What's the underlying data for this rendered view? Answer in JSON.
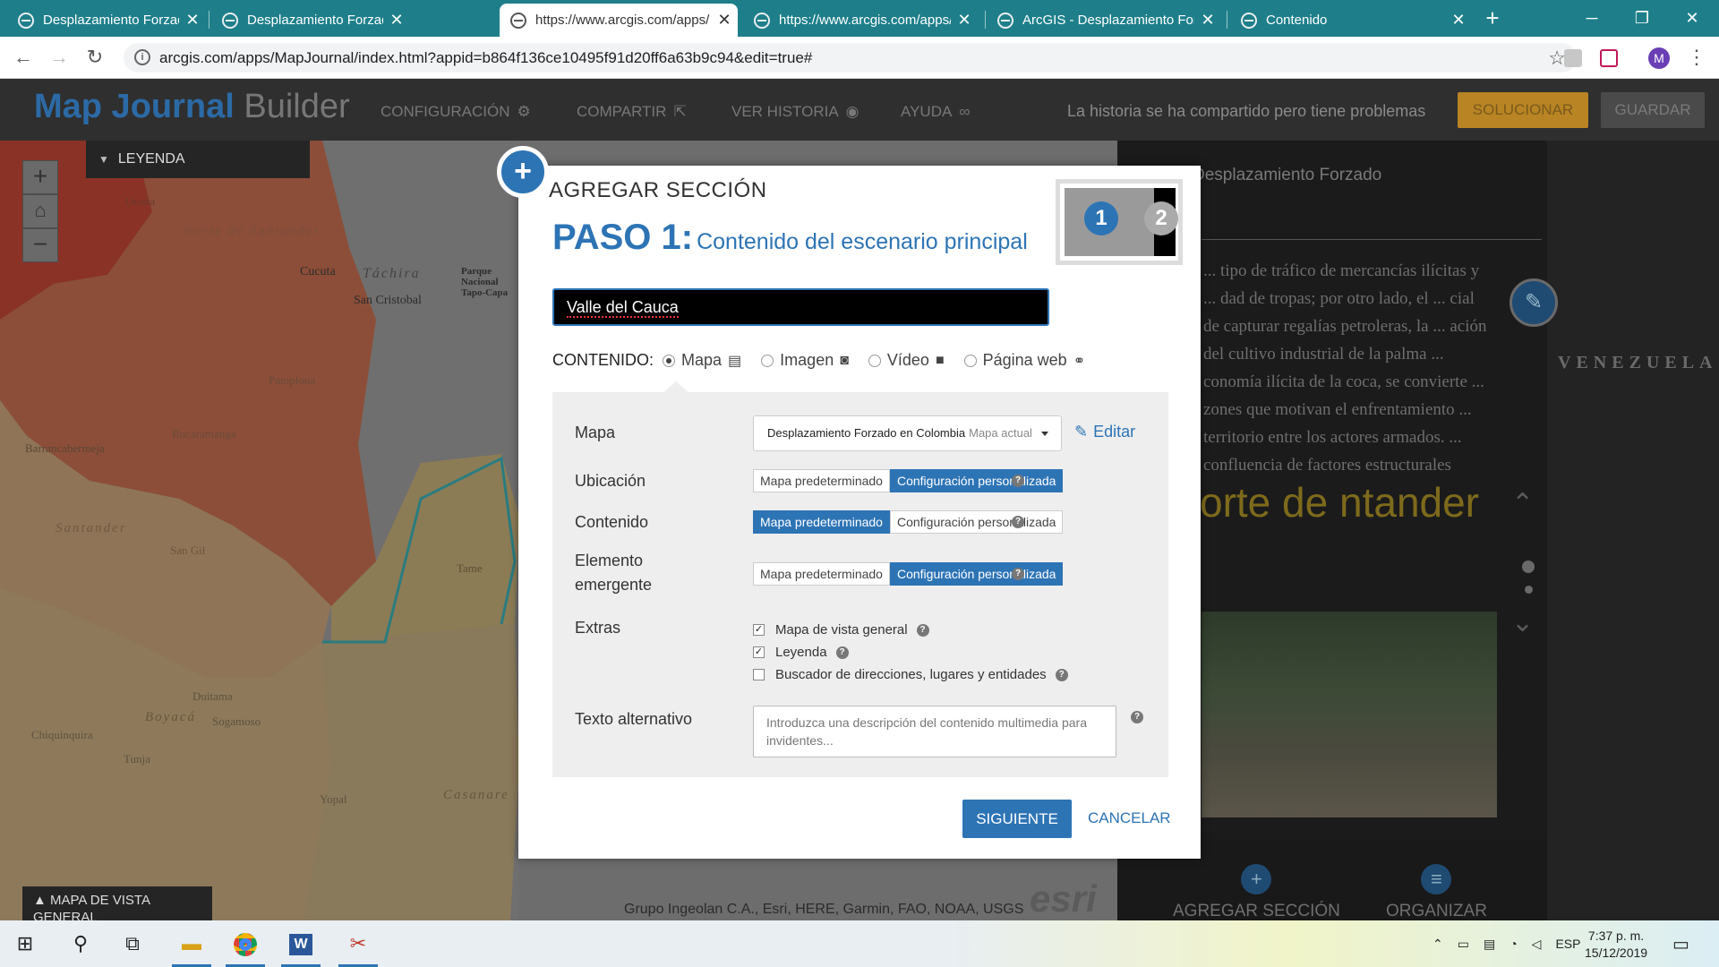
{
  "browser": {
    "tabs": [
      {
        "title": "Desplazamiento Forzado en C",
        "active": false
      },
      {
        "title": "Desplazamiento Forzado en C",
        "active": false
      },
      {
        "title": "https://www.arcgis.com/apps/",
        "active": true
      },
      {
        "title": "https://www.arcgis.com/apps/",
        "active": false
      },
      {
        "title": "ArcGIS - Desplazamiento For",
        "active": false
      },
      {
        "title": "Contenido",
        "active": false
      }
    ],
    "url": "arcgis.com/apps/MapJournal/index.html?appid=b864f136ce10495f91d20ff6a63b9c94&edit=true#",
    "profile_initial": "M"
  },
  "header": {
    "brand_bold": "Map Journal",
    "brand_light": " Builder",
    "nav": [
      {
        "label": "CONFIGURACIÓN",
        "icon": "gear-icon"
      },
      {
        "label": "COMPARTIR",
        "icon": "share-icon"
      },
      {
        "label": "VER HISTORIA",
        "icon": "eye-icon"
      },
      {
        "label": "AYUDA",
        "icon": "binoculars-icon"
      }
    ],
    "share_status": "La historia se ha compartido pero tiene problemas",
    "fix_label": "SOLUCIONAR",
    "save_label": "GUARDAR"
  },
  "map": {
    "legend_label": "LEYENDA",
    "overview_label": "MAPA DE VISTA GENERAL",
    "attribution": "Grupo Ingeolan C.A., Esri, HERE, Garmin, FAO, NOAA, USGS",
    "esri_logo": "esri",
    "places": [
      "Norte de Santander",
      "Cucuta",
      "San Cristobal",
      "Táchira",
      "Parque Nacional Tapo-Capa",
      "Ocaña",
      "Pamplona",
      "Bucaramanga",
      "Barrancabermeja",
      "Santander",
      "San Gil",
      "Tame",
      "Duitama",
      "Boyacá",
      "Sogamoso",
      "Chiquinquira",
      "Tunja",
      "Yopal",
      "Casanare"
    ]
  },
  "panel": {
    "map_title": "Desplazamiento Forzado",
    "body_text": "... tipo de tráfico de mercancías ilícitas y ... dad de tropas; por otro lado, el ... cial de capturar regalías petroleras, la ... ación del cultivo industrial de la palma ... conomía ilícita de la coca, se convierte ... zones que motivan el enfrentamiento ... territorio entre los actores armados. ... confluencia de factores estructurales",
    "heading": "orte de ntander",
    "venezuela": "VENEZUELA",
    "add_section": "AGREGAR SECCIÓN",
    "organize": "ORGANIZAR"
  },
  "dialog": {
    "title": "AGREGAR SECCIÓN",
    "step_label": "PASO 1:",
    "step_desc": "Contenido del escenario principal",
    "step_numbers": [
      "1",
      "2"
    ],
    "section_title_value": "Valle del Cauca",
    "content_label": "CONTENIDO:",
    "content_options": [
      {
        "label": "Mapa",
        "selected": true,
        "icon": "map-icon"
      },
      {
        "label": "Imagen",
        "selected": false,
        "icon": "camera-icon"
      },
      {
        "label": "Vídeo",
        "selected": false,
        "icon": "video-icon"
      },
      {
        "label": "Página web",
        "selected": false,
        "icon": "link-icon"
      }
    ],
    "map_label": "Mapa",
    "map_select_value": "Desplazamiento Forzado en Colombia",
    "map_select_suffix": "Mapa actual",
    "edit_label": "Editar",
    "rows": [
      {
        "label": "Ubicación",
        "options": [
          "Mapa predeterminado",
          "Configuración personalizada"
        ],
        "selected": 1
      },
      {
        "label": "Contenido",
        "options": [
          "Mapa predeterminado",
          "Configuración personalizada"
        ],
        "selected": 0
      },
      {
        "label": "Elemento emergente",
        "options": [
          "Mapa predeterminado",
          "Configuración personalizada"
        ],
        "selected": 1
      }
    ],
    "extras_label": "Extras",
    "extras": [
      {
        "label": "Mapa de vista general",
        "checked": true
      },
      {
        "label": "Leyenda",
        "checked": true
      },
      {
        "label": "Buscador de direcciones, lugares y entidades",
        "checked": false
      }
    ],
    "alt_label": "Texto alternativo",
    "alt_placeholder": "Introduzca una descripción del contenido multimedia para invidentes...",
    "next_label": "SIGUIENTE",
    "cancel_label": "CANCELAR"
  },
  "taskbar": {
    "language": "ESP",
    "time": "7:37 p. m.",
    "date": "15/12/2019"
  }
}
